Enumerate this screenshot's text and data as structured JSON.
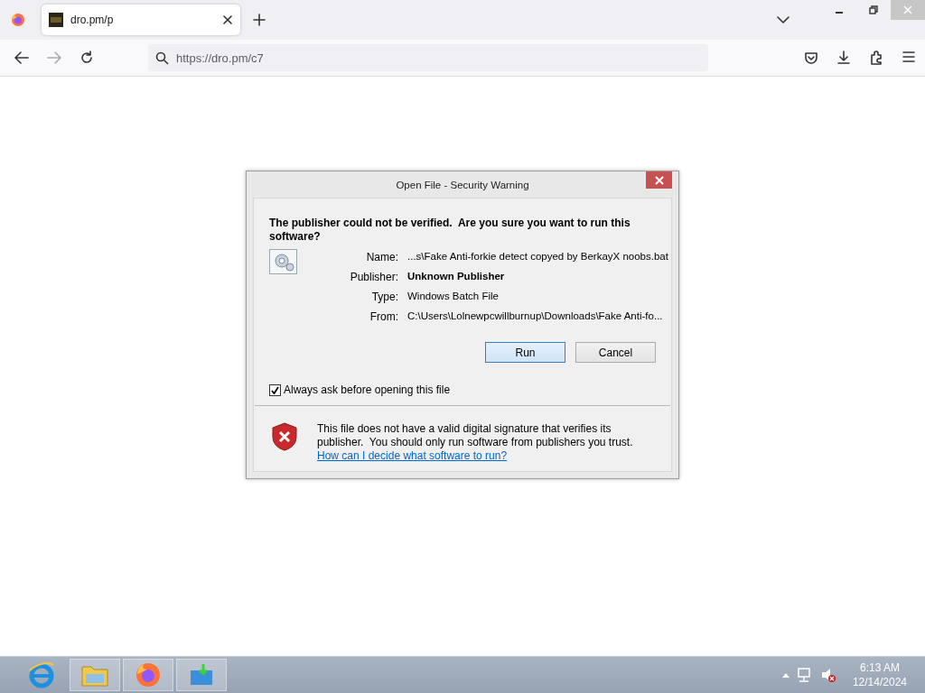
{
  "browser": {
    "tab": {
      "title": "dro.pm/p",
      "selected": true
    },
    "address": "https://dro.pm/c7"
  },
  "dialog": {
    "title": "Open File - Security Warning",
    "heading": "The publisher could not be verified.  Are you sure you want to run this software?",
    "fields": [
      {
        "label": "Name:",
        "value": "...s\\Fake Anti-forkie detect copyed by BerkayX noobs.bat",
        "kind": "plain"
      },
      {
        "label": "Publisher:",
        "value": "Unknown Publisher",
        "kind": "bold"
      },
      {
        "label": "Type:",
        "value": "Windows Batch File",
        "kind": "plain"
      },
      {
        "label": "From:",
        "value": "C:\\Users\\Lolnewpcwillburnup\\Downloads\\Fake Anti-fo...",
        "kind": "plain"
      }
    ],
    "buttons": [
      {
        "label": "Run",
        "default": true
      },
      {
        "label": "Cancel",
        "default": false
      }
    ],
    "checkbox": {
      "label": "Always ask before opening this file",
      "checked": true
    },
    "warning": "This file does not have a valid digital signature that verifies its publisher.  You should only run software from publishers you trust.",
    "help_link": "How can I decide what software to run?"
  },
  "taskbar": {
    "clock": {
      "time": "6:13 AM",
      "date": "12/14/2024"
    }
  }
}
